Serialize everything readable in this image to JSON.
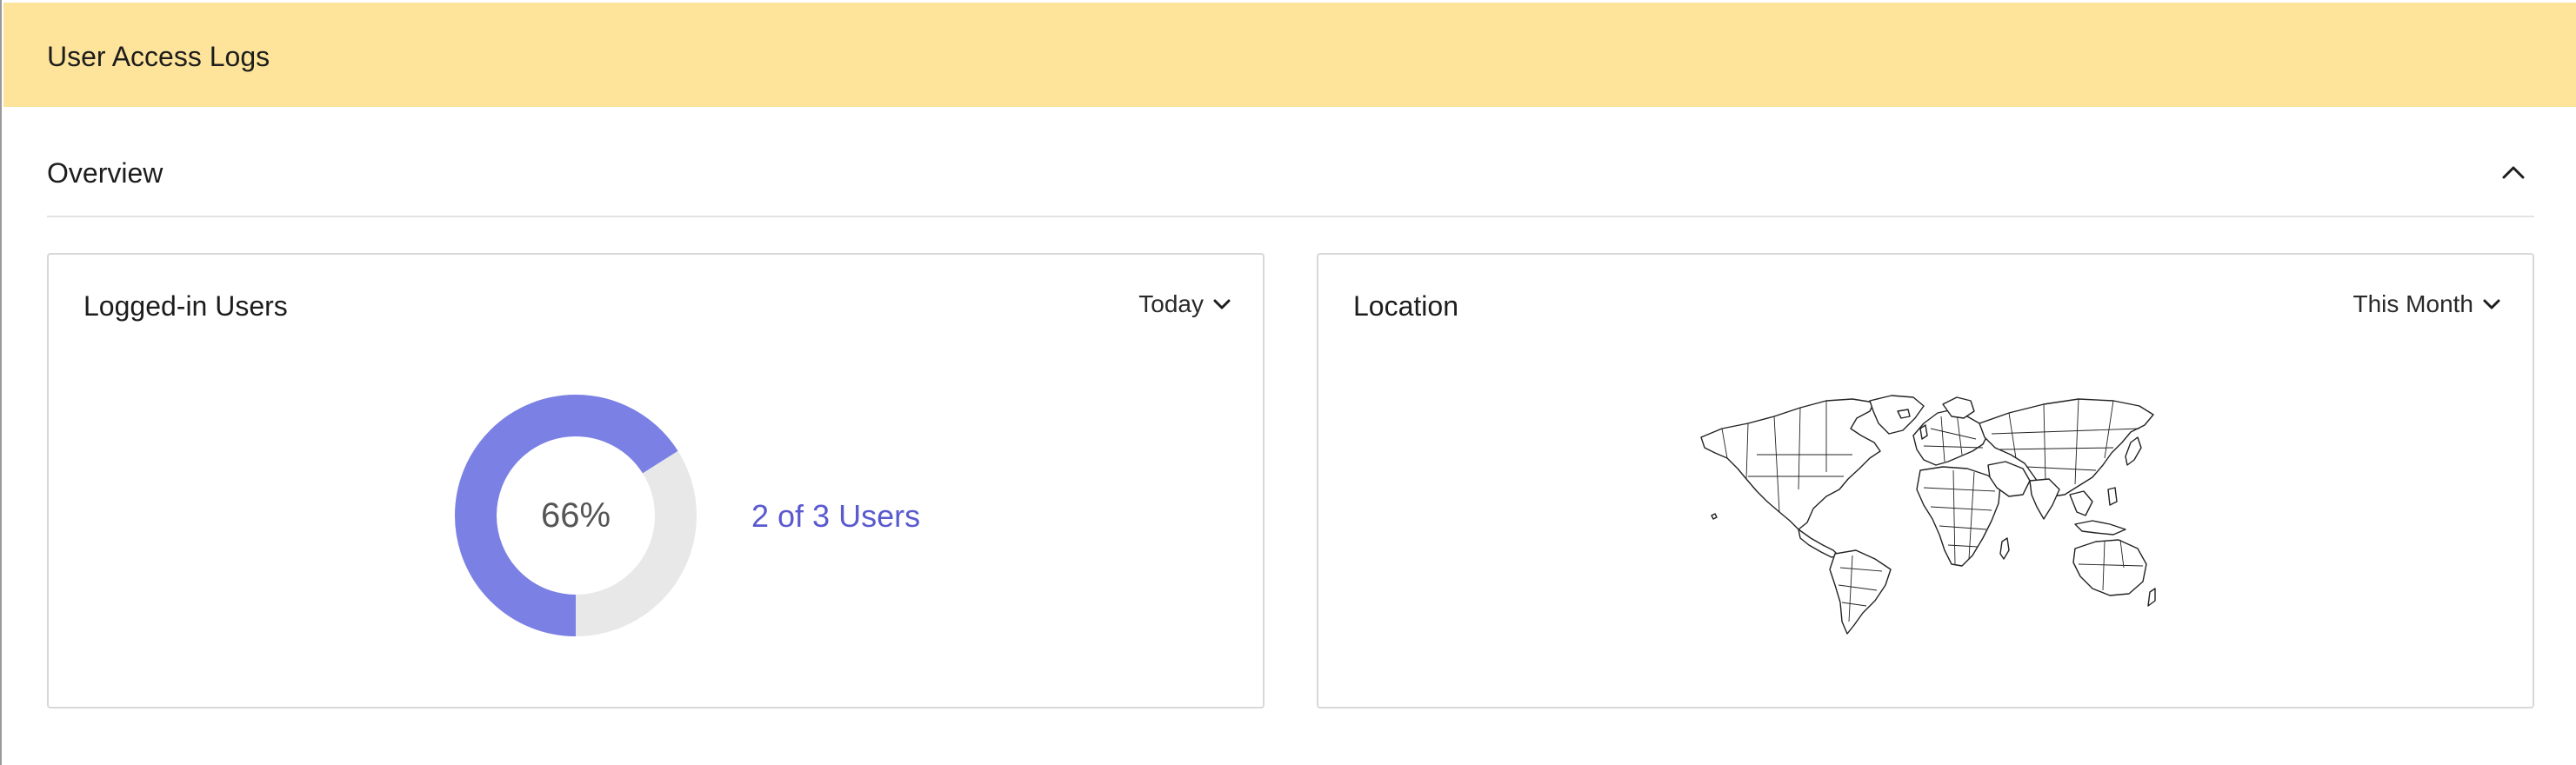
{
  "header": {
    "title": "User Access Logs"
  },
  "overview": {
    "title": "Overview",
    "collapse_icon": "chevron-up-icon"
  },
  "logged_in": {
    "title": "Logged-in Users",
    "period": "Today",
    "percent_label": "66%",
    "percent": 66,
    "users_label": "2 of 3 Users",
    "colors": {
      "filled": "#7b80e4",
      "remaining": "#e8e8e8",
      "label": "#5a5ad0"
    }
  },
  "location": {
    "title": "Location",
    "period": "This Month",
    "map_icon": "world-map"
  },
  "colors": {
    "header_bg": "#fde49a"
  }
}
